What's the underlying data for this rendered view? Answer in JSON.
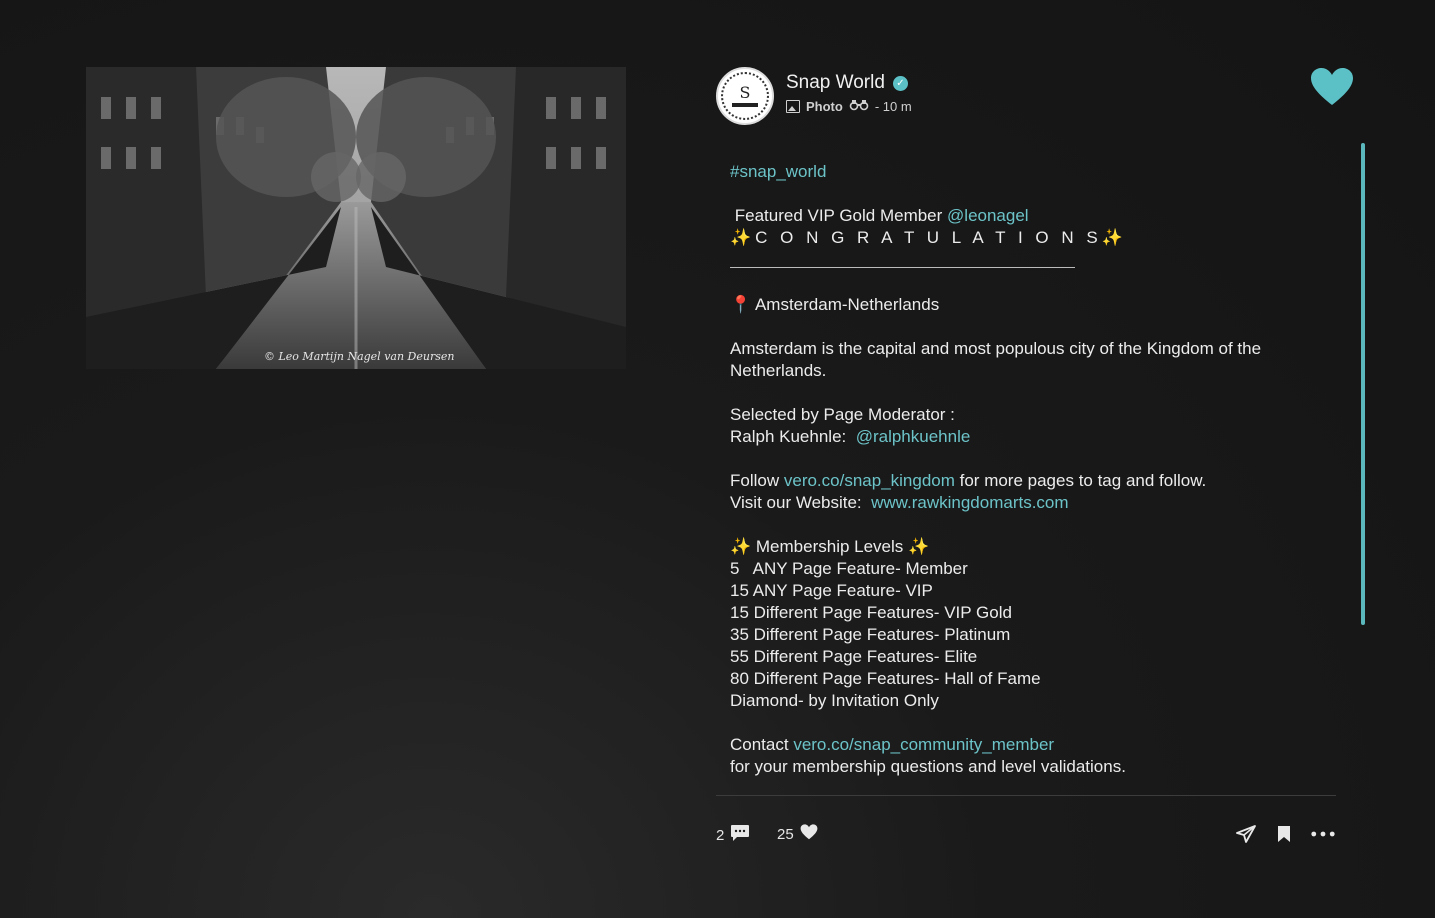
{
  "photo": {
    "watermark": "© Leo Martijn Nagel van Deursen"
  },
  "author": {
    "name": "Snap World",
    "post_type": "Photo",
    "time": "- 10 m",
    "avatar_letter": "S"
  },
  "caption": {
    "hashtag": "#snap_world",
    "featured_prefix": "Featured VIP Gold Member ",
    "featured_handle": "@leonagel",
    "congrats": "✨C O N G R A T U L A T I O N S✨",
    "location": "📍 Amsterdam-Netherlands",
    "description": "Amsterdam is the capital and most populous city of the Kingdom of the Netherlands.",
    "selected_by": "Selected by Page Moderator :",
    "moderator_name": "Ralph Kuehnle:  ",
    "moderator_handle": "@ralphkuehnle",
    "follow_prefix": "Follow ",
    "follow_link": "vero.co/snap_kingdom",
    "follow_suffix": " for more pages to tag and follow.",
    "website_prefix": "Visit our Website:  ",
    "website_link": "www.rawkingdomarts.com",
    "membership_title": "✨ Membership Levels ✨",
    "levels": [
      "5   ANY Page Feature- Member",
      "15 ANY Page Feature- VIP",
      "15 Different Page Features- VIP Gold",
      "35 Different Page Features- Platinum",
      "55 Different Page Features- Elite",
      "80 Different Page Features- Hall of Fame",
      "Diamond- by Invitation Only"
    ],
    "contact_prefix": "Contact ",
    "contact_link": "vero.co/snap_community_member",
    "contact_suffix": "for your membership questions and level validations."
  },
  "stats": {
    "comments": "2",
    "likes": "25"
  },
  "colors": {
    "accent": "#5cc1c6",
    "link": "#6cc3c8",
    "background": "#141414"
  }
}
